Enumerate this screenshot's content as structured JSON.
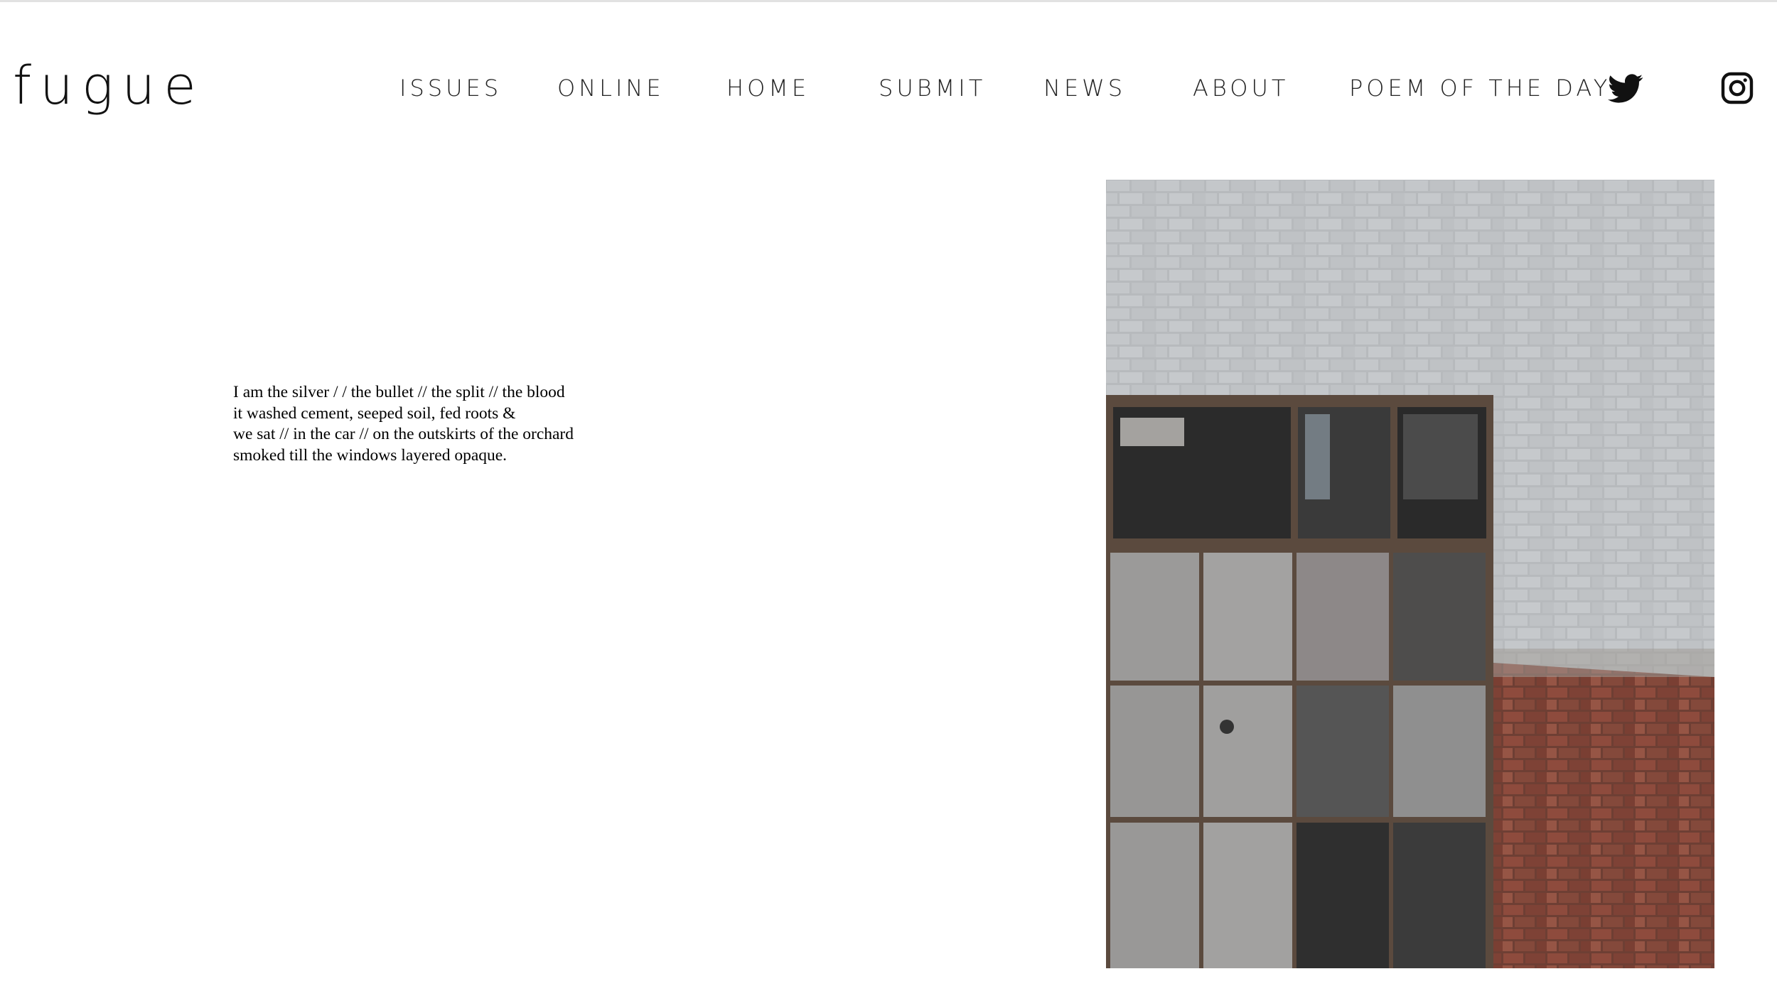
{
  "site": {
    "logo": "fugue"
  },
  "nav": {
    "items": [
      {
        "key": "issues",
        "label": "ISSUES"
      },
      {
        "key": "online",
        "label": "ONLINE"
      },
      {
        "key": "home",
        "label": "HOME"
      },
      {
        "key": "submit",
        "label": "SUBMIT"
      },
      {
        "key": "news",
        "label": "NEWS"
      },
      {
        "key": "about",
        "label": "ABOUT"
      },
      {
        "key": "poem-of-the-day",
        "label": "POEM OF THE DAY"
      }
    ],
    "social": [
      {
        "key": "twitter",
        "icon": "twitter-icon"
      },
      {
        "key": "instagram",
        "icon": "instagram-icon"
      }
    ]
  },
  "poem": {
    "lines": [
      "I am the silver / / the bullet // the split // the blood",
      "it washed cement, seeped soil, fed roots &",
      "we sat // in the car // on the outskirts of the orchard",
      "smoked till the windows layered opaque."
    ]
  },
  "image": {
    "subject": "brick-wall-with-weathered-window",
    "colors": {
      "paint": "#b9bcbf",
      "brick": "#8a4a3c",
      "frame": "#5b4a3e",
      "dark_pane": "#2e2e2e",
      "grey_pane": "#9a9a9a"
    }
  }
}
